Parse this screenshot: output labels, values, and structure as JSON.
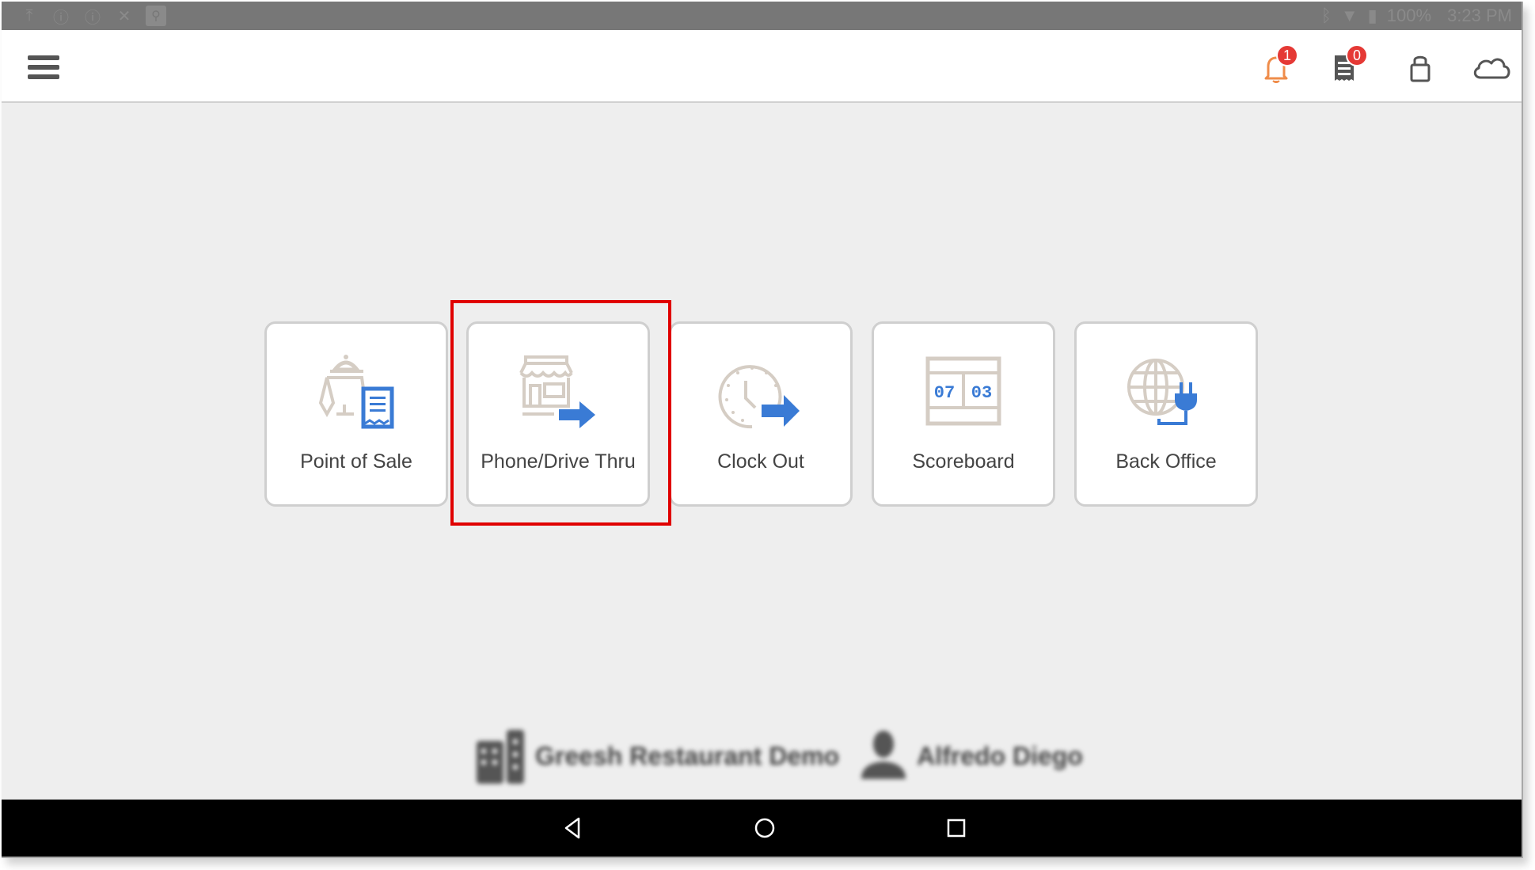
{
  "status_bar": {
    "left_icons": [
      "upload-icon",
      "info-icon",
      "info-icon",
      "signal-off-icon",
      "usb-icon"
    ],
    "right_icons": [
      "bluetooth-icon",
      "wifi-icon",
      "battery-charging-icon"
    ],
    "battery": "100%",
    "time": "3:23 PM"
  },
  "header": {
    "menu_icon": "hamburger-menu-icon",
    "notifications": {
      "icon": "bell-icon",
      "count": "1",
      "color": "#ef8c4a"
    },
    "orders": {
      "icon": "receipt-icon",
      "count": "0"
    },
    "lock_icon": "lock-icon",
    "cloud_icon": "cloud-icon",
    "badge_color": "#e53935"
  },
  "tiles": [
    {
      "label": "Point of Sale",
      "icon": "pos-terminal-receipt-icon"
    },
    {
      "label": "Phone/Drive Thru",
      "icon": "store-arrow-icon",
      "highlighted": true
    },
    {
      "label": "Clock Out",
      "icon": "clock-arrow-icon"
    },
    {
      "label": "Scoreboard",
      "icon": "scoreboard-icon",
      "digits_left": "07",
      "digits_right": "03"
    },
    {
      "label": "Back Office",
      "icon": "globe-plug-icon"
    }
  ],
  "footer": {
    "restaurant": "Greesh Restaurant Demo",
    "user": "Alfredo Diego"
  },
  "navbar": [
    "back-icon",
    "home-icon",
    "recents-icon"
  ],
  "colors": {
    "accent_blue": "#3a7bd5",
    "icon_beige": "#d5cdc4",
    "highlight_red": "#e00000",
    "background": "#eeeeee"
  }
}
